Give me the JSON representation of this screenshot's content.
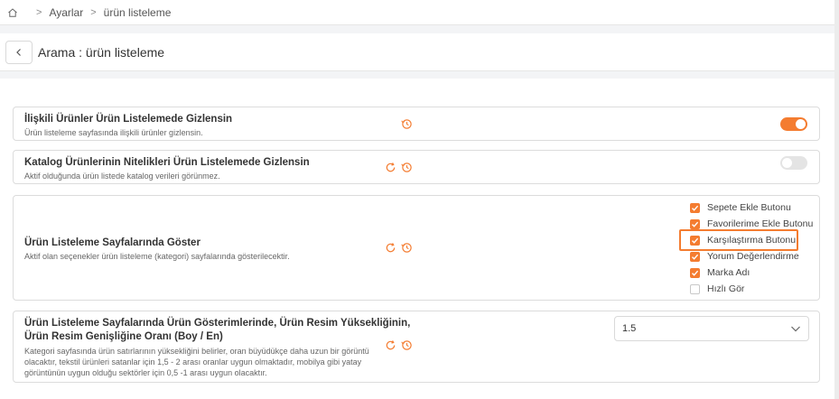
{
  "breadcrumb": {
    "items": [
      "Ayarlar",
      "ürün listeleme"
    ]
  },
  "header": {
    "title": "Arama : ürün listeleme"
  },
  "settings": [
    {
      "title": "İlişkili Ürünler Ürün Listelemede Gizlensin",
      "desc": "Ürün listeleme sayfasında ilişkili ürünler gizlensin.",
      "toggle": "on"
    },
    {
      "title": "Katalog Ürünlerinin Nitelikleri Ürün Listelemede Gizlensin",
      "desc": "Aktif olduğunda ürün listede katalog verileri görünmez.",
      "toggle": "off"
    },
    {
      "title": "Ürün Listeleme Sayfalarında Göster",
      "desc": "Aktif olan seçenekler ürün listeleme (kategori) sayfalarında gösterilecektir.",
      "options": [
        {
          "label": "Sepete Ekle Butonu",
          "checked": true
        },
        {
          "label": "Favorilerime Ekle Butonu",
          "checked": true
        },
        {
          "label": "Karşılaştırma Butonu",
          "checked": true
        },
        {
          "label": "Yorum Değerlendirme",
          "checked": true
        },
        {
          "label": "Marka Adı",
          "checked": true
        },
        {
          "label": "Hızlı Gör",
          "checked": false
        }
      ]
    },
    {
      "title_line1": "Ürün Listeleme Sayfalarında Ürün Gösterimlerinde, Ürün Resim Yüksekliğinin,",
      "title_line2": "Ürün Resim Genişliğine Oranı (Boy / En)",
      "desc_lines": [
        "Kategori sayfasında ürün satırlarının yüksekliğini belirler, oran büyüdükçe daha uzun bir görüntü",
        "olacaktır, tekstil ürünleri satanlar için 1,5 - 2 arası oranlar uygun olmaktadır, mobilya gibi yatay",
        "görüntünün uygun olduğu sektörler için 0,5 -1 arası uygun olacaktır."
      ],
      "select_value": "1.5"
    }
  ],
  "colors": {
    "accent": "#f47c30"
  },
  "icons": {
    "home": "home-icon",
    "reset": "reset-icon",
    "history": "history-icon",
    "back": "chevron-left-icon"
  }
}
